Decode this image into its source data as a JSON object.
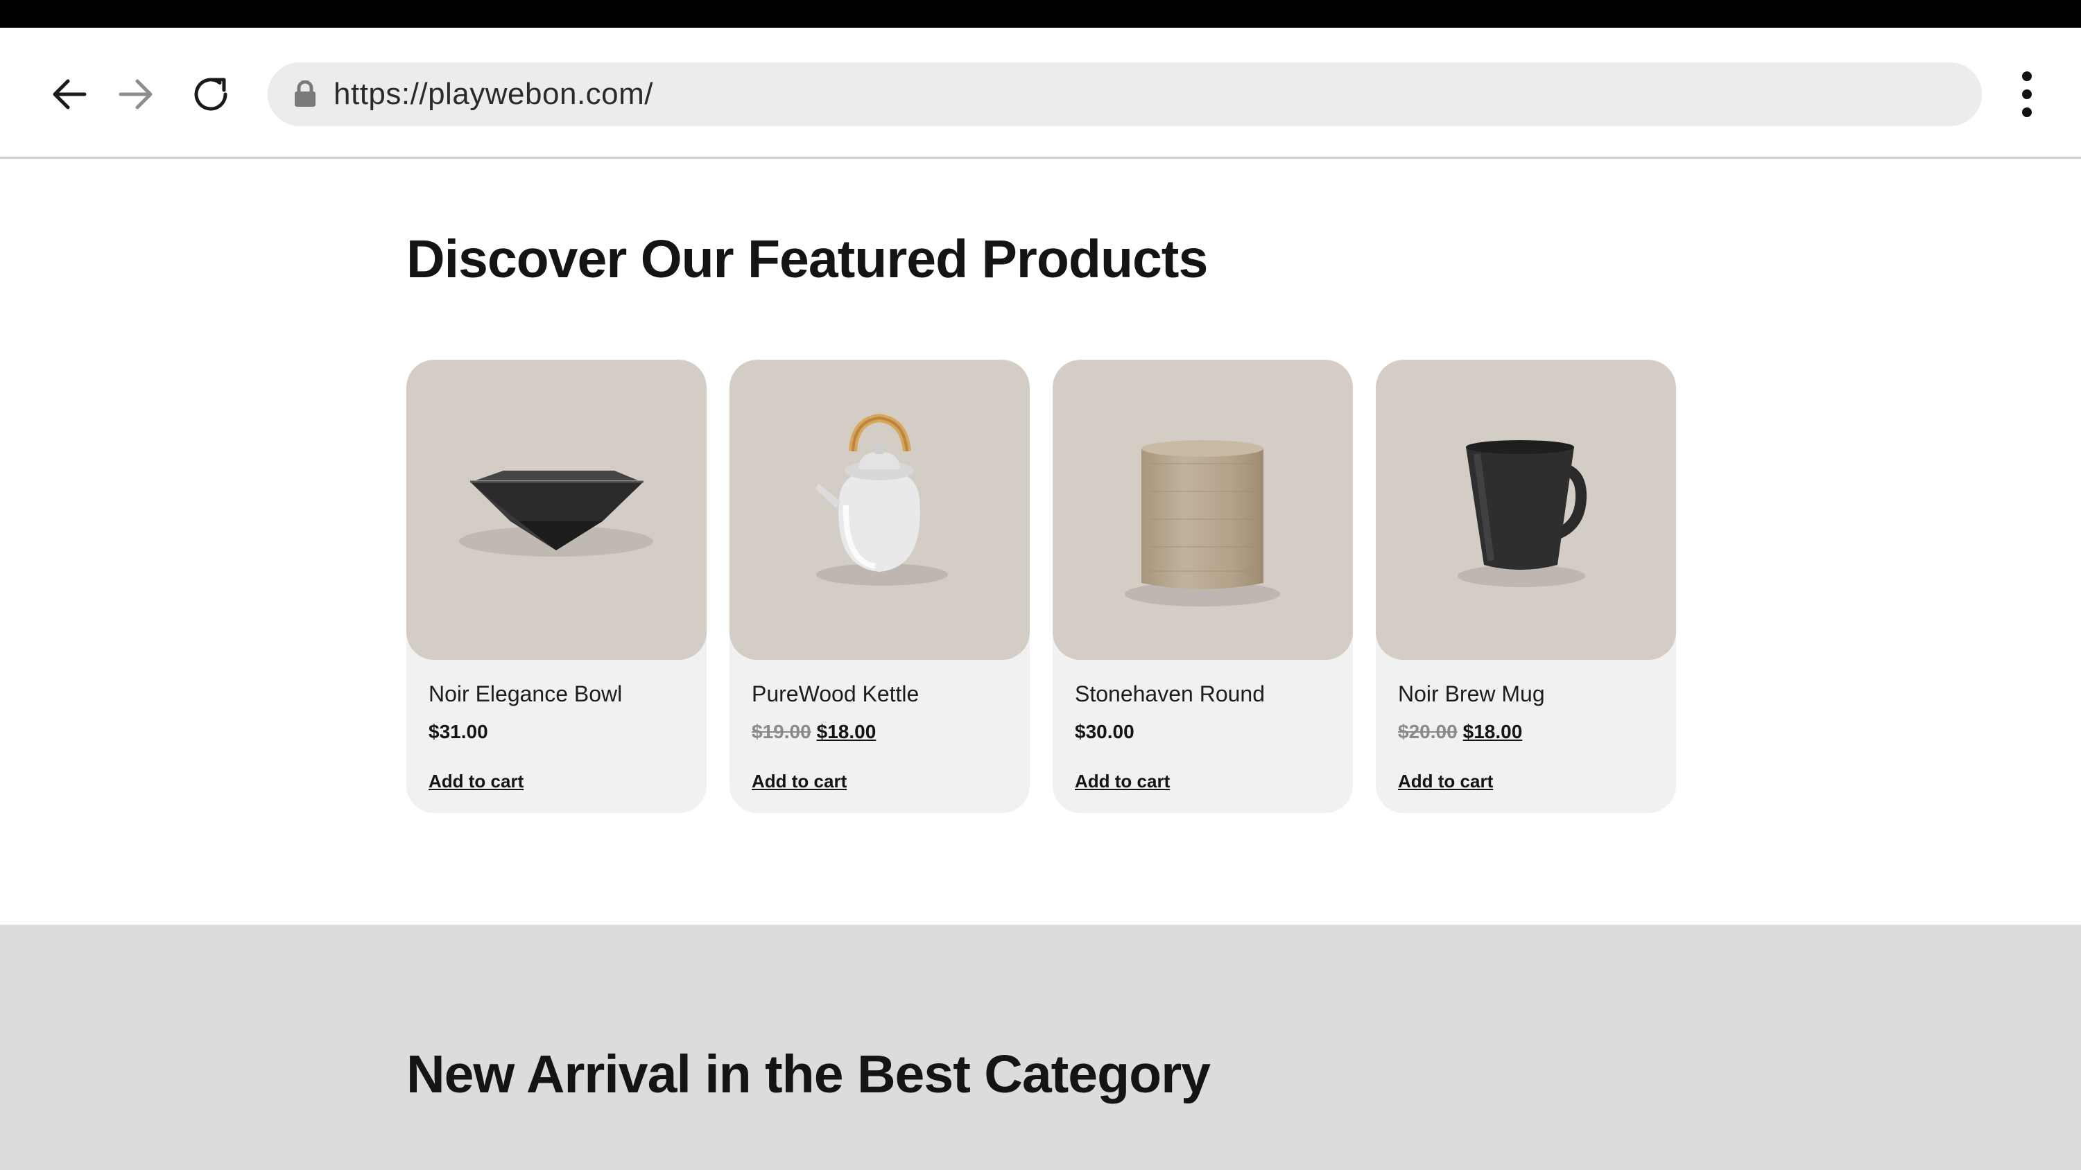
{
  "browser": {
    "url": "https://playwebon.com/",
    "icons": {
      "back": "arrow-left-icon",
      "forward": "arrow-right-icon",
      "reload": "reload-icon",
      "lock": "lock-icon",
      "menu": "vertical-dots-icon"
    }
  },
  "featured": {
    "title": "Discover Our Featured Products",
    "products": [
      {
        "name": "Noir Elegance Bowl",
        "price": "$31.00",
        "old_price": "",
        "sale_price": "",
        "add_to_cart": "Add to cart",
        "image": "black-square-bowl"
      },
      {
        "name": "PureWood Kettle",
        "price": "",
        "old_price": "$19.00",
        "sale_price": "$18.00",
        "add_to_cart": "Add to cart",
        "image": "white-teapot-with-wood-handle"
      },
      {
        "name": "Stonehaven Round",
        "price": "$30.00",
        "old_price": "",
        "sale_price": "",
        "add_to_cart": "Add to cart",
        "image": "textured-cylinder-stool"
      },
      {
        "name": "Noir Brew Mug",
        "price": "",
        "old_price": "$20.00",
        "sale_price": "$18.00",
        "add_to_cart": "Add to cart",
        "image": "black-mug"
      }
    ]
  },
  "arrival": {
    "title": "New Arrival in the Best Category"
  },
  "colors": {
    "card_image_bg": "#d3cdc6",
    "card_bg": "#f1f1f1",
    "section_gray": "#dcdcdc",
    "text": "#141414"
  }
}
